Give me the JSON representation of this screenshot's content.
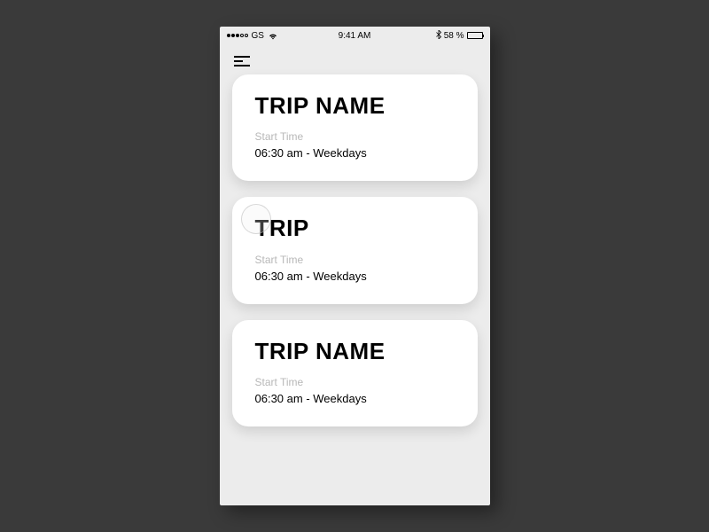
{
  "statusBar": {
    "carrier": "GS",
    "time": "9:41 AM",
    "batteryPercent": "58 %"
  },
  "trips": [
    {
      "title": "TRIP NAME",
      "label": "Start Time",
      "value": "06:30 am - Weekdays"
    },
    {
      "title": "TRIP",
      "label": "Start Time",
      "value": "06:30 am - Weekdays"
    },
    {
      "title": "TRIP NAME",
      "label": "Start Time",
      "value": "06:30 am - Weekdays"
    }
  ]
}
